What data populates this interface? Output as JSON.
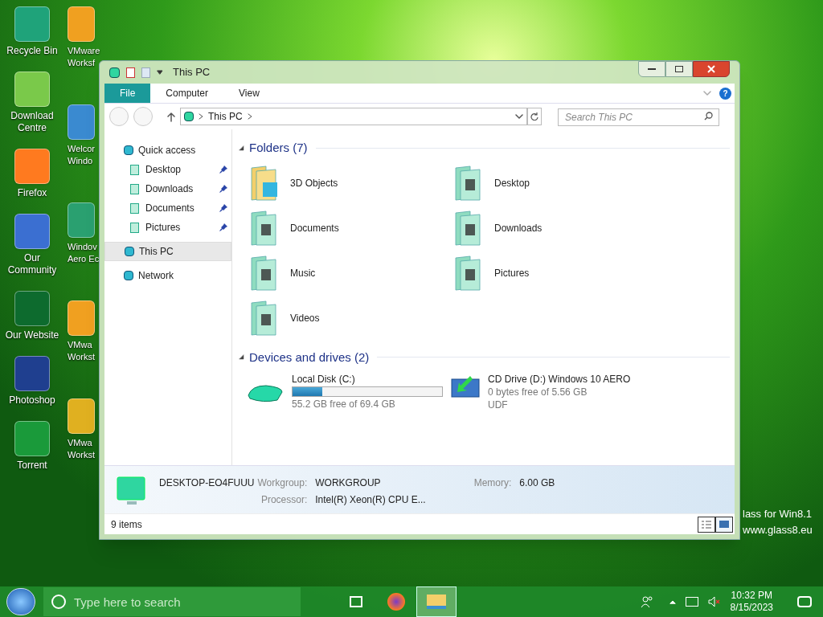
{
  "desktop": {
    "icons_left": [
      {
        "lines": [
          "Recycle Bin"
        ]
      },
      {
        "lines": [
          "Download",
          "Centre"
        ]
      },
      {
        "lines": [
          "Firefox"
        ]
      },
      {
        "lines": [
          "Our",
          "Community"
        ]
      },
      {
        "lines": [
          "Our Website"
        ]
      },
      {
        "lines": [
          "Photoshop"
        ]
      },
      {
        "lines": [
          "Torrent"
        ]
      }
    ],
    "icons_right": [
      {
        "lines": [
          "VMware",
          "Worksf"
        ]
      },
      {
        "lines": [
          "Welcor",
          "Windo"
        ]
      },
      {
        "lines": [
          "Windov",
          "Aero Ec"
        ]
      },
      {
        "lines": [
          "VMwa",
          "Workst"
        ]
      },
      {
        "lines": [
          "VMwa",
          "Workst"
        ]
      }
    ],
    "wallpaper_text": [
      "lass for Win8.1",
      "www.glass8.eu"
    ]
  },
  "window": {
    "title": "This PC",
    "help": "?",
    "ribbon_tabs": [
      {
        "label": "File",
        "selected": true
      },
      {
        "label": "Computer",
        "selected": false
      },
      {
        "label": "View",
        "selected": false
      }
    ],
    "address": {
      "path": "This PC",
      "search_placeholder": "Search This PC"
    },
    "sidebar": [
      {
        "label": "Quick access",
        "selected": false,
        "children": [
          {
            "label": "Desktop",
            "pinned": true
          },
          {
            "label": "Downloads",
            "pinned": true
          },
          {
            "label": "Documents",
            "pinned": true
          },
          {
            "label": "Pictures",
            "pinned": true
          }
        ]
      },
      {
        "label": "This PC",
        "selected": true
      },
      {
        "label": "Network",
        "selected": false
      }
    ],
    "folders": {
      "title": "Folders (7)",
      "expanded": true,
      "items": [
        "3D Objects",
        "Desktop",
        "Documents",
        "Downloads",
        "Music",
        "Pictures",
        "Videos"
      ]
    },
    "devices": {
      "title": "Devices and drives (2)",
      "expanded": true,
      "items": [
        {
          "kind": "disk",
          "name": "Local Disk (C:)",
          "level": 0.2,
          "lines": [
            "55.2 GB free of 69.4 GB"
          ]
        },
        {
          "kind": "cd",
          "name": "CD Drive (D:) Windows 10 AERO",
          "lines": [
            "0 bytes free of 5.56 GB",
            "UDF"
          ]
        }
      ]
    },
    "details": {
      "computer_name": "DESKTOP-EO4FUUU",
      "fields": [
        {
          "label": "Workgroup:",
          "value": "WORKGROUP"
        },
        {
          "label": "Memory:",
          "value": "6.00 GB"
        },
        {
          "label": "Processor:",
          "value": "Intel(R) Xeon(R) CPU E..."
        }
      ]
    },
    "status": "9 items"
  },
  "taskbar": {
    "search_placeholder": "Type here to search",
    "apps": [
      {
        "kind": "taskview",
        "selected": false
      },
      {
        "kind": "firefox",
        "selected": false
      },
      {
        "kind": "explorer",
        "selected": true
      }
    ],
    "time": "10:32 PM",
    "date": "8/15/2023"
  }
}
